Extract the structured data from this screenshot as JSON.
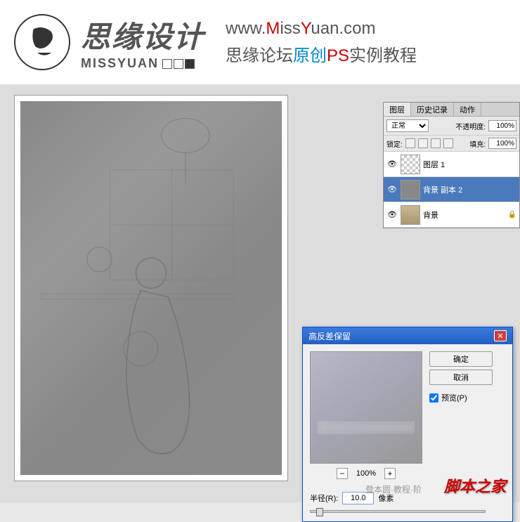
{
  "header": {
    "logo_main": "思缘设计",
    "logo_sub": "MISSYUAN",
    "url_prefix": "www.",
    "url_m": "M",
    "url_iss": "iss",
    "url_y": "Y",
    "url_suffix": "uan.com",
    "tagline_p1": "思缘论坛",
    "tagline_p2": "原创",
    "tagline_p3": "PS",
    "tagline_p4": "实例教程"
  },
  "layers_panel": {
    "tabs": [
      "图层",
      "历史记录",
      "动作"
    ],
    "blend_mode": "正常",
    "opacity_label": "不透明度:",
    "opacity_value": "100%",
    "lock_label": "锁定:",
    "fill_label": "填充:",
    "fill_value": "100%",
    "layers": [
      {
        "name": "图层 1",
        "thumb": "checker",
        "selected": false
      },
      {
        "name": "背景 副本 2",
        "thumb": "gray",
        "selected": true
      },
      {
        "name": "背景",
        "thumb": "photo",
        "selected": false,
        "locked": true
      }
    ]
  },
  "dialog": {
    "title": "高反差保留",
    "ok_btn": "确定",
    "cancel_btn": "取消",
    "preview_label": "预览(P)",
    "zoom_level": "100%",
    "radius_label": "半径(R):",
    "radius_value": "10.0",
    "radius_unit": "像素"
  },
  "watermark": "脚本之家",
  "watermark2": "登本圆·教程·阶"
}
